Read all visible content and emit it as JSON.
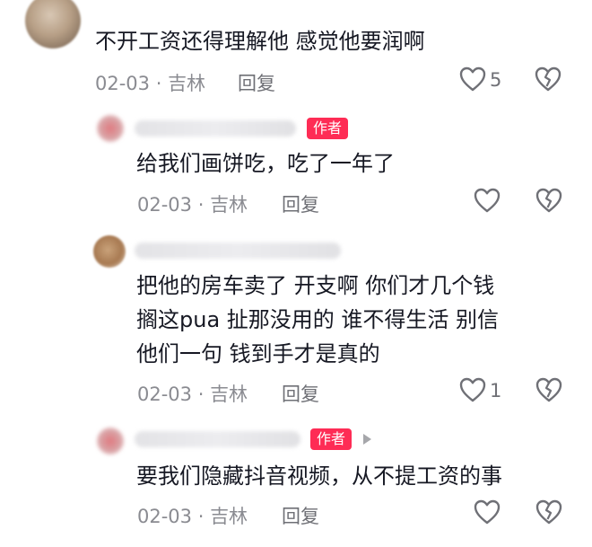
{
  "author_tag": "作者",
  "reply_label": "回复",
  "comments": [
    {
      "text": [
        "不开工资还得理解他   感觉他要润啊"
      ],
      "date": "02-03",
      "location": "吉林",
      "likes": "5"
    },
    {
      "text": [
        "给我们画饼吃，吃了一年了"
      ],
      "date": "02-03",
      "location": "吉林",
      "likes": ""
    },
    {
      "text": [
        "把他的房车卖了  开支啊  你们才几个钱",
        "搁这pua  扯那没用的 谁不得生活   别信",
        "他们一句  钱到手才是真的"
      ],
      "date": "02-03",
      "location": "吉林",
      "likes": "1"
    },
    {
      "text": [
        "要我们隐藏抖音视频，从不提工资的事"
      ],
      "date": "02-03",
      "location": "吉林",
      "likes": ""
    }
  ],
  "icons": {
    "like": "heart-outline-icon",
    "dislike": "broken-heart-icon",
    "more": "play-triangle-icon"
  },
  "colors": {
    "author_tag_bg": "#fe2c55",
    "text": "#161823",
    "meta": "#8a8b91"
  }
}
